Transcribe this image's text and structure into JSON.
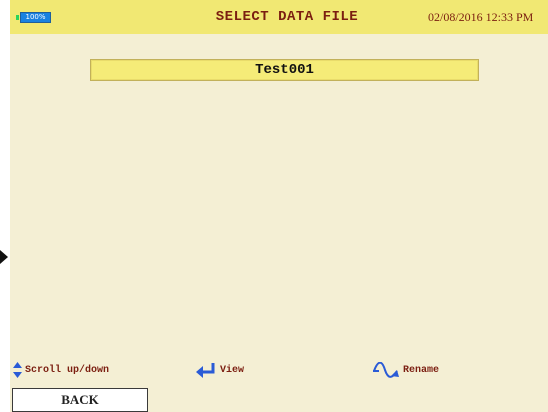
{
  "header": {
    "title": "SELECT DATA FILE",
    "datetime": "02/08/2016 12:33 PM",
    "battery_label": "100%"
  },
  "files": [
    {
      "name": "Test001",
      "selected": true
    }
  ],
  "legend": {
    "scroll_label": "Scroll up/down",
    "view_label": "View",
    "rename_label": "Rename"
  },
  "buttons": {
    "back_label": "BACK"
  },
  "icons": {
    "scroll": "up-down-arrows-icon",
    "view": "enter-arrow-icon",
    "rename": "sine-wave-arrow-icon",
    "left_edge": "chevron-right-icon"
  },
  "colors": {
    "background": "#f4efd4",
    "header": "#f1e873",
    "text_accent": "#7b1e10",
    "selection": "#f5ec78",
    "icon_blue": "#2a5bd6"
  }
}
